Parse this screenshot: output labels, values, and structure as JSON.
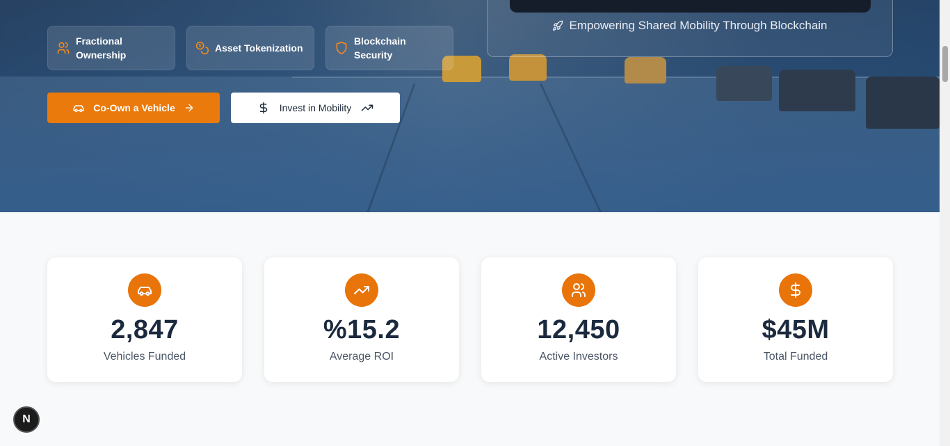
{
  "hero": {
    "features": [
      {
        "label_line1": "Fractional",
        "label_line2": "Ownership",
        "icon": "users-icon"
      },
      {
        "label_line1": "Asset Tokenization",
        "label_line2": "",
        "icon": "coins-icon"
      },
      {
        "label_line1": "Blockchain",
        "label_line2": "Security",
        "icon": "shield-icon"
      }
    ],
    "primary_button": {
      "label": "Co-Own a Vehicle",
      "icon": "car-icon",
      "trailing_icon": "arrow-right-icon"
    },
    "secondary_button": {
      "label": "Invest in Mobility",
      "icon": "dollar-icon",
      "trailing_icon": "trending-up-icon"
    },
    "showcase_caption": "Empowering Shared Mobility Through Blockchain",
    "showcase_icon": "rocket-icon"
  },
  "stats": [
    {
      "value": "2,847",
      "label": "Vehicles Funded",
      "icon": "car-icon"
    },
    {
      "value": "%15.2",
      "label": "Average ROI",
      "icon": "trending-up-icon"
    },
    {
      "value": "12,450",
      "label": "Active Investors",
      "icon": "users-icon"
    },
    {
      "value": "$45M",
      "label": "Total Funded",
      "icon": "dollar-icon"
    }
  ],
  "badge": {
    "label": "N"
  },
  "colors": {
    "accent": "#ea7a0c",
    "dark_text": "#1b2a3e",
    "hero_blue": "#2d5887"
  }
}
